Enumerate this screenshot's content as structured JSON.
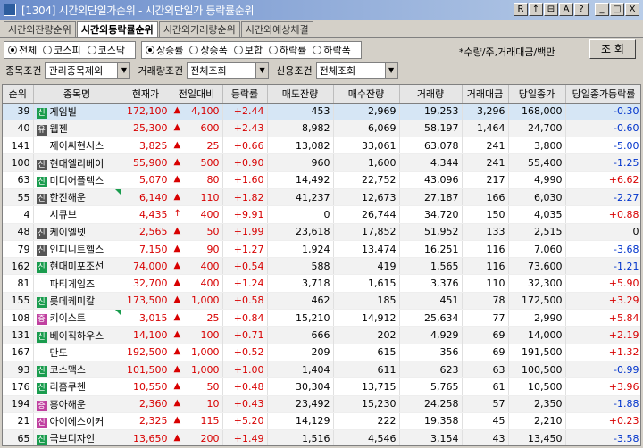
{
  "window": {
    "title": "[1304] 시간외단일가순위 - 시간외단일가 등락률순위"
  },
  "titlebar_buttons": [
    "R",
    "↑",
    "⊟",
    "A",
    "?",
    "_",
    "□",
    "X"
  ],
  "tabs": [
    {
      "label": "시간외잔량순위",
      "active": false
    },
    {
      "label": "시간외등락률순위",
      "active": true
    },
    {
      "label": "시간외거래량순위",
      "active": false
    },
    {
      "label": "시간외예상체결",
      "active": false
    }
  ],
  "market_radios": [
    {
      "label": "전체",
      "on": true
    },
    {
      "label": "코스피",
      "on": false
    },
    {
      "label": "코스닥",
      "on": false
    }
  ],
  "rank_radios": [
    {
      "label": "상승률",
      "on": true
    },
    {
      "label": "상승폭",
      "on": false
    },
    {
      "label": "보합",
      "on": false
    },
    {
      "label": "하락률",
      "on": false
    },
    {
      "label": "하락폭",
      "on": false
    }
  ],
  "unit_note": "*수량/주,거래대금/백만",
  "query_button": "조 회",
  "filters": {
    "stock_cond_label": "종목조건",
    "stock_cond_value": "관리종목제외",
    "volume_cond_label": "거래량조건",
    "volume_cond_value": "전체조회",
    "credit_cond_label": "신용조건",
    "credit_cond_value": "전체조회"
  },
  "columns": [
    "순위",
    "종목명",
    "현재가",
    "전일대비",
    "등락률",
    "매도잔량",
    "매수잔량",
    "거래량",
    "거래대금",
    "당일종가",
    "당일종가등락률"
  ],
  "colors": {
    "up": "#d80000",
    "down": "#0033cc",
    "badge_green": "#1a9c4e",
    "badge_gray": "#555555",
    "badge_pink": "#c040a0"
  },
  "rows": [
    {
      "rank": "39",
      "badge": "신",
      "badge_color": "green",
      "name": "게임빌",
      "price": "172,100",
      "arrow": "▲",
      "diff": "4,100",
      "rate": "+2.44",
      "ask": "453",
      "bid": "2,969",
      "vol": "19,253",
      "amt": "3,296",
      "close": "168,000",
      "close_rate": "-0.30",
      "dir": "down",
      "corner": false
    },
    {
      "rank": "40",
      "badge": "유",
      "badge_color": "gray",
      "name": "웹젠",
      "price": "25,300",
      "arrow": "▲",
      "diff": "600",
      "rate": "+2.43",
      "ask": "8,982",
      "bid": "6,069",
      "vol": "58,197",
      "amt": "1,464",
      "close": "24,700",
      "close_rate": "-0.60",
      "dir": "down",
      "corner": false
    },
    {
      "rank": "141",
      "badge": "",
      "badge_color": "",
      "name": "제이씨현시스",
      "price": "3,825",
      "arrow": "▲",
      "diff": "25",
      "rate": "+0.66",
      "ask": "13,082",
      "bid": "33,061",
      "vol": "63,078",
      "amt": "241",
      "close": "3,800",
      "close_rate": "-5.00",
      "dir": "down",
      "corner": false
    },
    {
      "rank": "100",
      "badge": "신",
      "badge_color": "gray",
      "name": "현대엘리베이",
      "price": "55,900",
      "arrow": "▲",
      "diff": "500",
      "rate": "+0.90",
      "ask": "960",
      "bid": "1,600",
      "vol": "4,344",
      "amt": "241",
      "close": "55,400",
      "close_rate": "-1.25",
      "dir": "down",
      "corner": false
    },
    {
      "rank": "63",
      "badge": "신",
      "badge_color": "green",
      "name": "미디어플렉스",
      "price": "5,070",
      "arrow": "▲",
      "diff": "80",
      "rate": "+1.60",
      "ask": "14,492",
      "bid": "22,752",
      "vol": "43,096",
      "amt": "217",
      "close": "4,990",
      "close_rate": "+6.62",
      "dir": "up",
      "corner": false
    },
    {
      "rank": "55",
      "badge": "신",
      "badge_color": "gray",
      "name": "한진해운",
      "price": "6,140",
      "arrow": "▲",
      "diff": "110",
      "rate": "+1.82",
      "ask": "41,237",
      "bid": "12,673",
      "vol": "27,187",
      "amt": "166",
      "close": "6,030",
      "close_rate": "-2.27",
      "dir": "down",
      "corner": true
    },
    {
      "rank": "4",
      "badge": "",
      "badge_color": "",
      "name": "시큐브",
      "price": "4,435",
      "arrow": "↑",
      "diff": "400",
      "rate": "+9.91",
      "ask": "0",
      "bid": "26,744",
      "vol": "34,720",
      "amt": "150",
      "close": "4,035",
      "close_rate": "+0.88",
      "dir": "up",
      "corner": false
    },
    {
      "rank": "48",
      "badge": "신",
      "badge_color": "gray",
      "name": "케이엘넷",
      "price": "2,565",
      "arrow": "▲",
      "diff": "50",
      "rate": "+1.99",
      "ask": "23,618",
      "bid": "17,852",
      "vol": "51,952",
      "amt": "133",
      "close": "2,515",
      "close_rate": "0",
      "dir": "flat",
      "corner": false
    },
    {
      "rank": "79",
      "badge": "신",
      "badge_color": "gray",
      "name": "인피니트헬스",
      "price": "7,150",
      "arrow": "▲",
      "diff": "90",
      "rate": "+1.27",
      "ask": "1,924",
      "bid": "13,474",
      "vol": "16,251",
      "amt": "116",
      "close": "7,060",
      "close_rate": "-3.68",
      "dir": "down",
      "corner": false
    },
    {
      "rank": "162",
      "badge": "신",
      "badge_color": "green",
      "name": "현대미포조선",
      "price": "74,000",
      "arrow": "▲",
      "diff": "400",
      "rate": "+0.54",
      "ask": "588",
      "bid": "419",
      "vol": "1,565",
      "amt": "116",
      "close": "73,600",
      "close_rate": "-1.21",
      "dir": "down",
      "corner": false
    },
    {
      "rank": "81",
      "badge": "",
      "badge_color": "",
      "name": "파티게임즈",
      "price": "32,700",
      "arrow": "▲",
      "diff": "400",
      "rate": "+1.24",
      "ask": "3,718",
      "bid": "1,615",
      "vol": "3,376",
      "amt": "110",
      "close": "32,300",
      "close_rate": "+5.90",
      "dir": "up",
      "corner": false
    },
    {
      "rank": "155",
      "badge": "신",
      "badge_color": "green",
      "name": "롯데케미칼",
      "price": "173,500",
      "arrow": "▲",
      "diff": "1,000",
      "rate": "+0.58",
      "ask": "462",
      "bid": "185",
      "vol": "451",
      "amt": "78",
      "close": "172,500",
      "close_rate": "+3.29",
      "dir": "up",
      "corner": false
    },
    {
      "rank": "108",
      "badge": "증",
      "badge_color": "pink",
      "name": "키이스트",
      "price": "3,015",
      "arrow": "▲",
      "diff": "25",
      "rate": "+0.84",
      "ask": "15,210",
      "bid": "14,912",
      "vol": "25,634",
      "amt": "77",
      "close": "2,990",
      "close_rate": "+5.84",
      "dir": "up",
      "corner": true
    },
    {
      "rank": "131",
      "badge": "신",
      "badge_color": "green",
      "name": "베이직하우스",
      "price": "14,100",
      "arrow": "▲",
      "diff": "100",
      "rate": "+0.71",
      "ask": "666",
      "bid": "202",
      "vol": "4,929",
      "amt": "69",
      "close": "14,000",
      "close_rate": "+2.19",
      "dir": "up",
      "corner": false
    },
    {
      "rank": "167",
      "badge": "",
      "badge_color": "",
      "name": "만도",
      "price": "192,500",
      "arrow": "▲",
      "diff": "1,000",
      "rate": "+0.52",
      "ask": "209",
      "bid": "615",
      "vol": "356",
      "amt": "69",
      "close": "191,500",
      "close_rate": "+1.32",
      "dir": "up",
      "corner": false
    },
    {
      "rank": "93",
      "badge": "신",
      "badge_color": "green",
      "name": "코스맥스",
      "price": "101,500",
      "arrow": "▲",
      "diff": "1,000",
      "rate": "+1.00",
      "ask": "1,404",
      "bid": "611",
      "vol": "623",
      "amt": "63",
      "close": "100,500",
      "close_rate": "-0.99",
      "dir": "down",
      "corner": false
    },
    {
      "rank": "176",
      "badge": "신",
      "badge_color": "green",
      "name": "리홈쿠첸",
      "price": "10,550",
      "arrow": "▲",
      "diff": "50",
      "rate": "+0.48",
      "ask": "30,304",
      "bid": "13,715",
      "vol": "5,765",
      "amt": "61",
      "close": "10,500",
      "close_rate": "+3.96",
      "dir": "up",
      "corner": false
    },
    {
      "rank": "194",
      "badge": "증",
      "badge_color": "pink",
      "name": "흥아해운",
      "price": "2,360",
      "arrow": "▲",
      "diff": "10",
      "rate": "+0.43",
      "ask": "23,492",
      "bid": "15,230",
      "vol": "24,258",
      "amt": "57",
      "close": "2,350",
      "close_rate": "-1.88",
      "dir": "down",
      "corner": false
    },
    {
      "rank": "21",
      "badge": "신",
      "badge_color": "pink",
      "name": "아이에스이커",
      "price": "2,325",
      "arrow": "▲",
      "diff": "115",
      "rate": "+5.20",
      "ask": "14,129",
      "bid": "222",
      "vol": "19,358",
      "amt": "45",
      "close": "2,210",
      "close_rate": "+0.23",
      "dir": "up",
      "corner": false
    },
    {
      "rank": "65",
      "badge": "신",
      "badge_color": "green",
      "name": "국보디자인",
      "price": "13,650",
      "arrow": "▲",
      "diff": "200",
      "rate": "+1.49",
      "ask": "1,516",
      "bid": "4,546",
      "vol": "3,154",
      "amt": "43",
      "close": "13,450",
      "close_rate": "-3.58",
      "dir": "down",
      "corner": false
    }
  ]
}
